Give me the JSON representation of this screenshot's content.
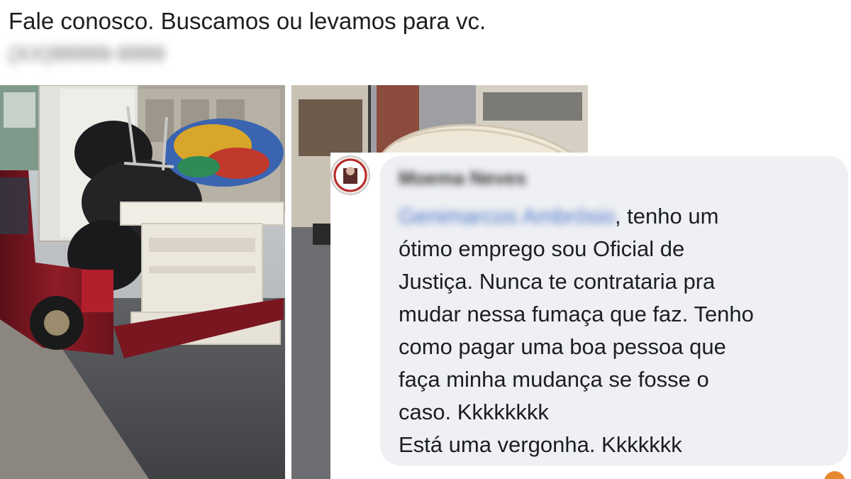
{
  "post": {
    "text": "Fale conosco. Buscamos ou levamos para vc.",
    "phone_blurred": "(XX)99999-9999"
  },
  "photos": {
    "left_alt": "red pickup truck loaded with furniture and bags",
    "right_alt": "street with mattress on truck"
  },
  "comment": {
    "commenter_name": "Moema Neves",
    "mention": "Genimarcos Ambrósio",
    "lines": [
      ", tenho um",
      "ótimo emprego sou Oficial de",
      "Justiça.  Nunca te contrataria pra",
      "mudar nessa fumaça que faz. Tenho",
      "como pagar uma boa pessoa que",
      "faça minha mudança se fosse o",
      "caso. Kkkkkkkk",
      "Está  uma vergonha. Kkkkkkk"
    ]
  },
  "colors": {
    "bubble": "#eef0f3",
    "mention": "#4a74c9",
    "text": "#1c1e21"
  }
}
